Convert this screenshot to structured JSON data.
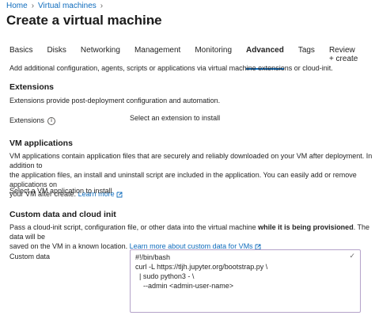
{
  "breadcrumb": [
    {
      "label": "Home"
    },
    {
      "label": "Virtual machines"
    }
  ],
  "page_title": "Create a virtual machine",
  "more_label": "···",
  "tabs": [
    {
      "label": "Basics",
      "active": false
    },
    {
      "label": "Disks",
      "active": false
    },
    {
      "label": "Networking",
      "active": false
    },
    {
      "label": "Management",
      "active": false
    },
    {
      "label": "Monitoring",
      "active": false
    },
    {
      "label": "Advanced",
      "active": true
    },
    {
      "label": "Tags",
      "active": false
    },
    {
      "label": "Review + create",
      "active": false
    }
  ],
  "intro": "Add additional configuration, agents, scripts or applications via virtual machine extensions or cloud-init.",
  "extensions": {
    "heading": "Extensions",
    "description": "Extensions provide post-deployment configuration and automation.",
    "field_label": "Extensions",
    "select_link": "Select an extension to install"
  },
  "vm_apps": {
    "heading": "VM applications",
    "description_line1": "VM applications contain application files that are securely and reliably downloaded on your VM after deployment. In addition to",
    "description_line2": "the application files, an install and uninstall script are included in the application. You can easily add or remove applications on",
    "description_line3": "your VM after create.",
    "learn_more": "Learn more",
    "select_link": "Select a VM application to install"
  },
  "custom_data": {
    "heading": "Custom data and cloud init",
    "description_part1": "Pass a cloud-init script, configuration file, or other data into the virtual machine ",
    "description_bold": "while it is being provisioned",
    "description_part2": ". The data will be",
    "description_line2": "saved on the VM in a known location.",
    "learn_more": "Learn more about custom data for VMs",
    "field_label": "Custom data",
    "value": "#!/bin/bash\ncurl -L https://tljh.jupyter.org/bootstrap.py \\\n  | sudo python3 - \\\n    --admin <admin-user-name>"
  },
  "icons": {
    "info": "info-icon",
    "external": "external-link-icon",
    "check": "checkmark-icon"
  },
  "colors": {
    "link": "#0f6cbd",
    "active_tab_underline": "#0f6cbd",
    "textarea_border": "#b4a2c9"
  }
}
